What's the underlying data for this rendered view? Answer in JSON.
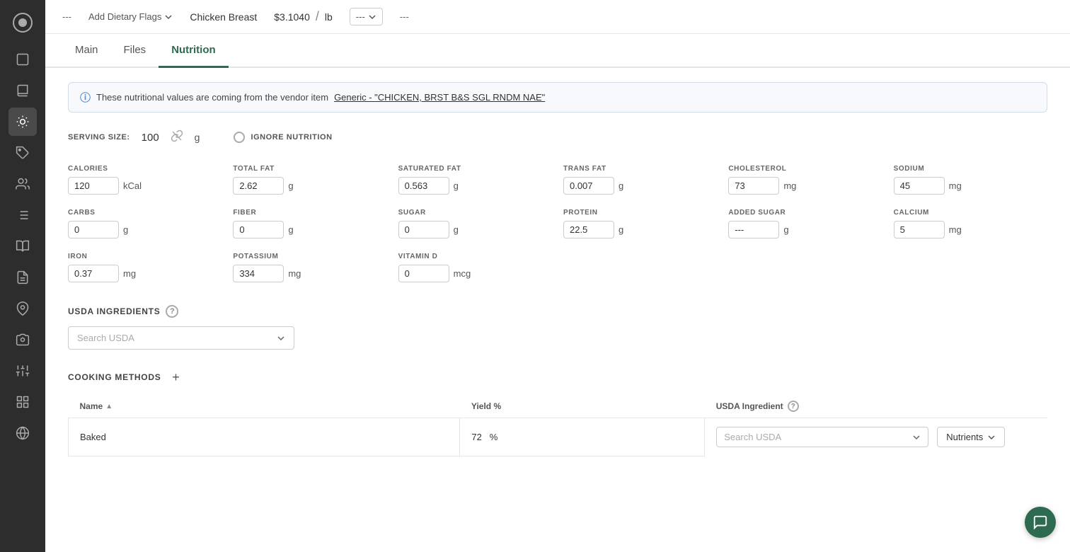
{
  "sidebar": {
    "icons": [
      {
        "name": "logo-icon",
        "symbol": "🔑",
        "active": false
      },
      {
        "name": "package-icon",
        "symbol": "▭",
        "active": false
      },
      {
        "name": "book-icon",
        "symbol": "📖",
        "active": false
      },
      {
        "name": "chef-icon",
        "symbol": "⚙",
        "active": true
      },
      {
        "name": "tag2-icon",
        "symbol": "🏷",
        "active": false
      },
      {
        "name": "people-icon",
        "symbol": "👥",
        "active": false
      },
      {
        "name": "list-icon",
        "symbol": "≡",
        "active": false
      },
      {
        "name": "book2-icon",
        "symbol": "📋",
        "active": false
      },
      {
        "name": "report-icon",
        "symbol": "📄",
        "active": false
      },
      {
        "name": "location-icon",
        "symbol": "📍",
        "active": false
      },
      {
        "name": "camera-icon",
        "symbol": "🎥",
        "active": false
      },
      {
        "name": "sliders-icon",
        "symbol": "⚙",
        "active": false
      },
      {
        "name": "grid-icon",
        "symbol": "⊞",
        "active": false
      },
      {
        "name": "globe-icon",
        "symbol": "🌐",
        "active": false
      }
    ]
  },
  "topbar": {
    "dashes1": "---",
    "add_flags_label": "Add Dietary Flags",
    "product_name": "Chicken Breast",
    "price": "$3.1040",
    "slash": "/",
    "unit": "lb",
    "dashes2": "---",
    "dropdown_value": "---",
    "dashes3": "---"
  },
  "tabs": [
    {
      "label": "Main",
      "active": false
    },
    {
      "label": "Files",
      "active": false
    },
    {
      "label": "Nutrition",
      "active": true
    }
  ],
  "info_banner": {
    "text": "These nutritional values are coming from the vendor item",
    "link_text": "Generic - \"CHICKEN, BRST B&S SGL RNDM NAE\""
  },
  "serving": {
    "label": "SERVING SIZE:",
    "value": "100",
    "unit": "g",
    "ignore_label": "IGNORE NUTRITION"
  },
  "nutrients": [
    {
      "label": "CALORIES",
      "value": "120",
      "unit": "kCal"
    },
    {
      "label": "TOTAL FAT",
      "value": "2.62",
      "unit": "g"
    },
    {
      "label": "SATURATED FAT",
      "value": "0.563",
      "unit": "g"
    },
    {
      "label": "TRANS FAT",
      "value": "0.007",
      "unit": "g"
    },
    {
      "label": "CHOLESTEROL",
      "value": "73",
      "unit": "mg"
    },
    {
      "label": "SODIUM",
      "value": "45",
      "unit": "mg"
    },
    {
      "label": "CARBS",
      "value": "0",
      "unit": "g"
    },
    {
      "label": "FIBER",
      "value": "0",
      "unit": "g"
    },
    {
      "label": "SUGAR",
      "value": "0",
      "unit": "g"
    },
    {
      "label": "PROTEIN",
      "value": "22.5",
      "unit": "g"
    },
    {
      "label": "ADDED SUGAR",
      "value": "---",
      "unit": "g"
    },
    {
      "label": "CALCIUM",
      "value": "5",
      "unit": "mg"
    },
    {
      "label": "IRON",
      "value": "0.37",
      "unit": "mg"
    },
    {
      "label": "POTASSIUM",
      "value": "334",
      "unit": "mg"
    },
    {
      "label": "VITAMIN D",
      "value": "0",
      "unit": "mcg"
    }
  ],
  "usda_ingredients": {
    "section_title": "USDA INGREDIENTS",
    "search_placeholder": "Search USDA"
  },
  "cooking_methods": {
    "section_title": "COOKING METHODS",
    "columns": {
      "name": "Name",
      "yield": "Yield %",
      "usda_ingredient": "USDA Ingredient"
    },
    "rows": [
      {
        "name": "Baked",
        "yield": "72",
        "yield_unit": "%",
        "usda_search_placeholder": "Search USDA",
        "nutrients_label": "Nutrients"
      }
    ]
  },
  "fab": {
    "icon": "💬"
  }
}
